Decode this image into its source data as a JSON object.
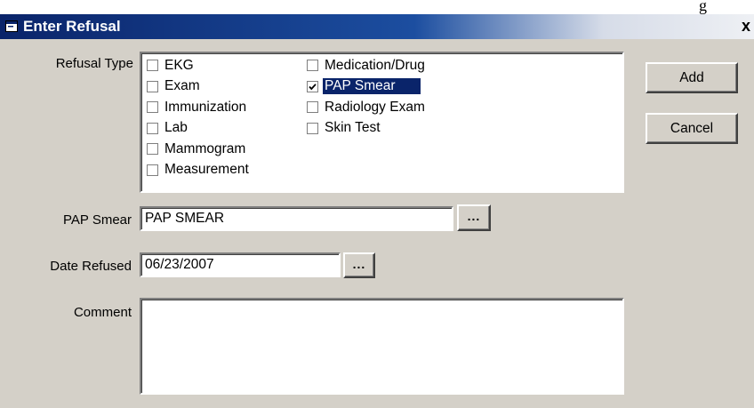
{
  "corner_text": "g",
  "window": {
    "title": "Enter Refusal",
    "close_label": "x"
  },
  "refusal_type": {
    "label": "Refusal Type",
    "column1": [
      {
        "label": "EKG",
        "checked": false
      },
      {
        "label": "Exam",
        "checked": false
      },
      {
        "label": "Immunization",
        "checked": false
      },
      {
        "label": "Lab",
        "checked": false
      },
      {
        "label": "Mammogram",
        "checked": false
      },
      {
        "label": "Measurement",
        "checked": false
      }
    ],
    "column2": [
      {
        "label": "Medication/Drug",
        "checked": false
      },
      {
        "label": "PAP Smear",
        "checked": true,
        "selected": true
      },
      {
        "label": "Radiology Exam",
        "checked": false
      },
      {
        "label": "Skin Test",
        "checked": false
      }
    ]
  },
  "pap_smear": {
    "label": "PAP Smear",
    "value": "PAP SMEAR",
    "browse_label": "..."
  },
  "date_refused": {
    "label": "Date Refused",
    "value": "06/23/2007",
    "browse_label": "..."
  },
  "comment": {
    "label": "Comment",
    "value": ""
  },
  "buttons": {
    "add": "Add",
    "cancel": "Cancel"
  },
  "colors": {
    "title_bar": "#0a246a",
    "face": "#d4d0c8",
    "selection": "#0a246a"
  }
}
